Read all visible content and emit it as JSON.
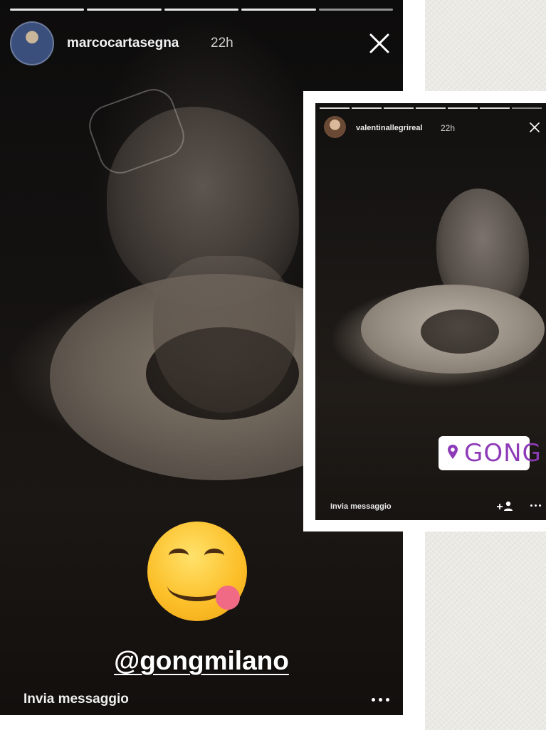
{
  "main_story": {
    "username": "marcocartasegna",
    "time": "22h",
    "mention": "@gongmilano",
    "reply_label": "Invia messaggio",
    "progress_segments": 5,
    "progress_done": 4,
    "icons": {
      "close": "close-icon",
      "more": "more-options-icon",
      "emoji": "face-savoring-food-emoji"
    }
  },
  "inset_story": {
    "username": "valentinallegrireal",
    "time": "22h",
    "location_sticker": "GONG",
    "reply_label": "Invia messaggio",
    "progress_segments": 7,
    "progress_done": 6,
    "icons": {
      "close": "close-icon",
      "location": "location-pin-icon",
      "add_user": "add-user-icon",
      "more": "more-options-icon"
    },
    "colors": {
      "location_accent": "#8e3bb8"
    }
  }
}
